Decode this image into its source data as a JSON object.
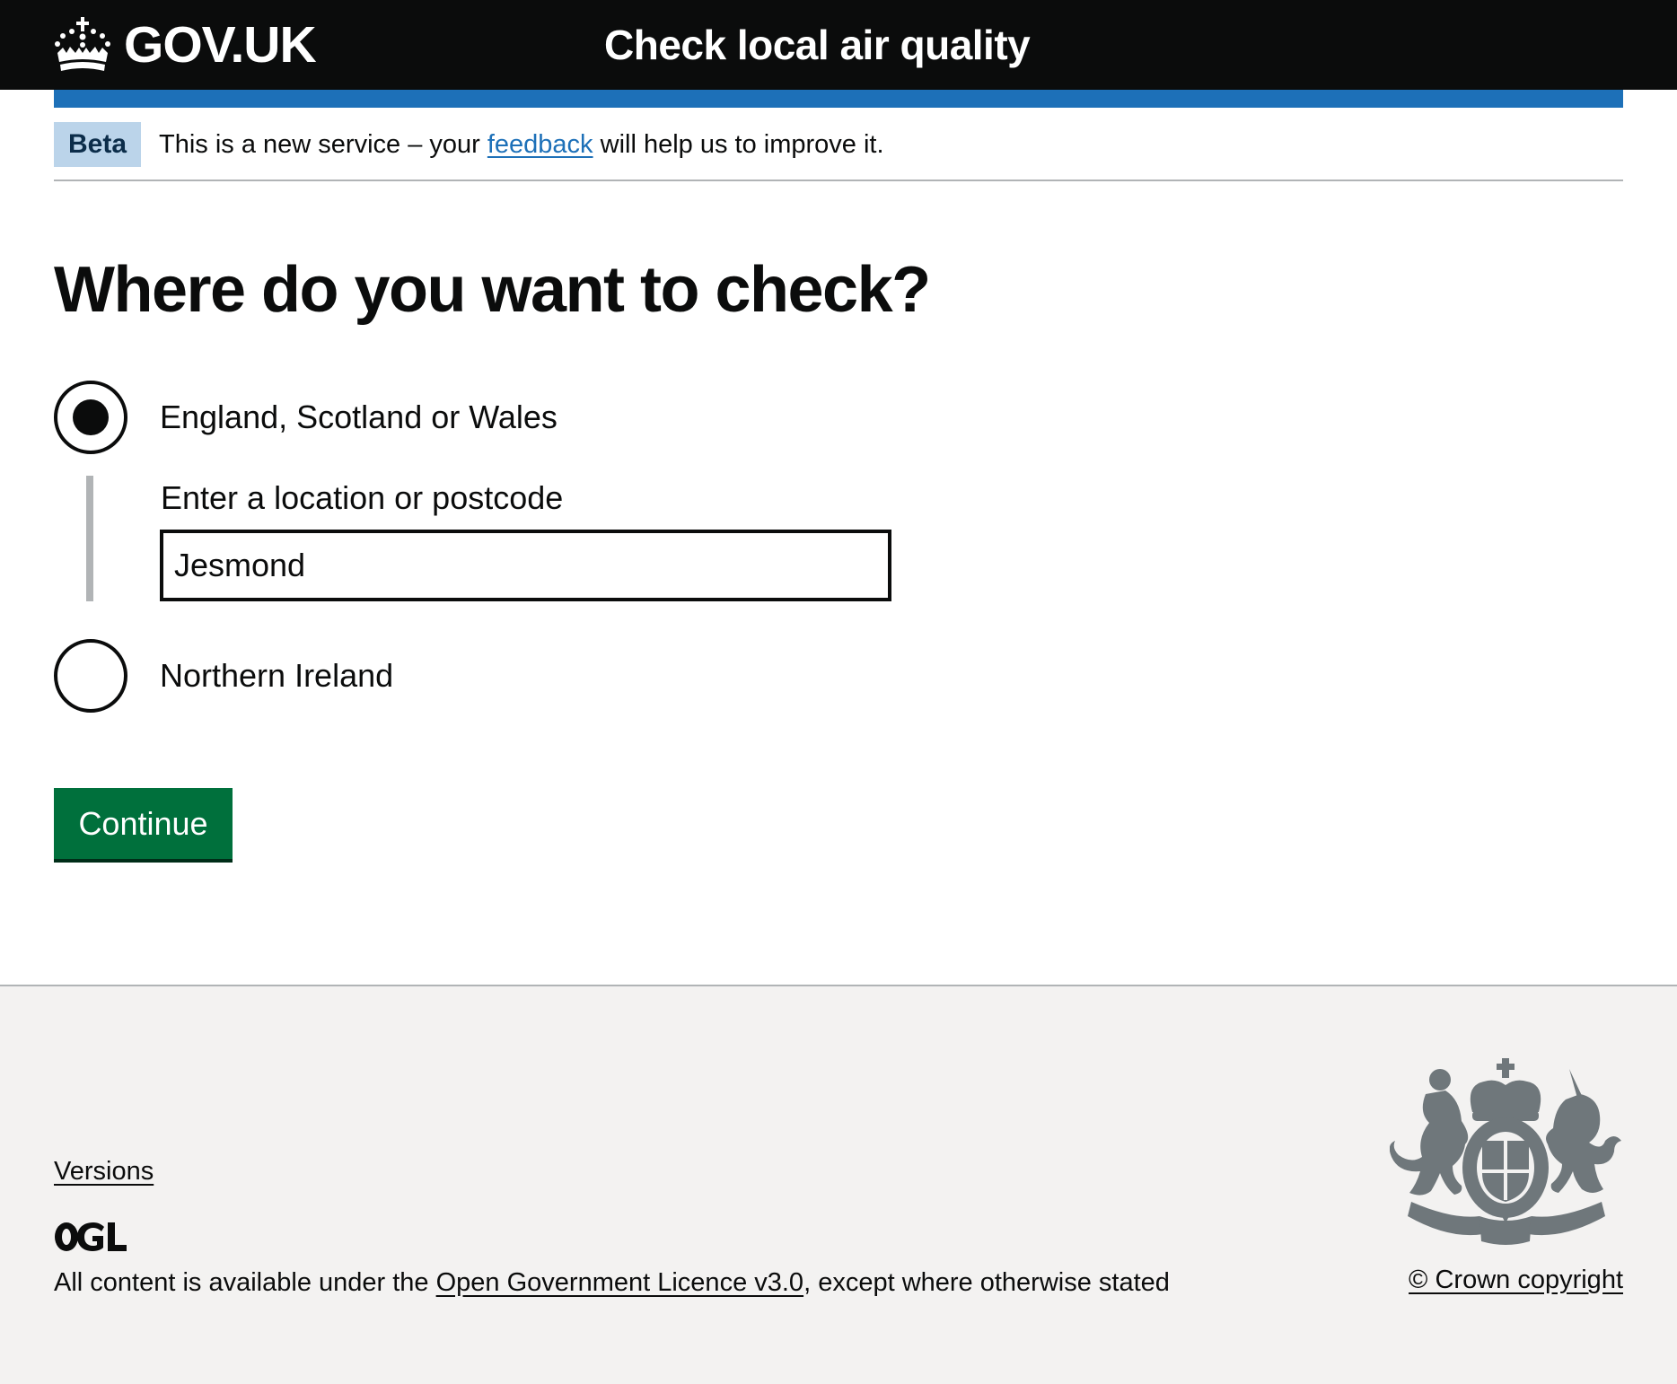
{
  "header": {
    "logo_text": "GOV.UK",
    "service_name": "Check local air quality"
  },
  "phase_banner": {
    "tag": "Beta",
    "text_before": "This is a new service – your ",
    "link_text": "feedback",
    "text_after": " will help us to improve it."
  },
  "main": {
    "heading": "Where do you want to check?",
    "options": [
      {
        "label": "England, Scotland or Wales",
        "selected": true
      },
      {
        "label": "Northern Ireland",
        "selected": false
      }
    ],
    "conditional": {
      "label": "Enter a location or postcode",
      "input_value": "Jesmond"
    },
    "continue_label": "Continue"
  },
  "footer": {
    "versions_link": "Versions",
    "ogl_logo": "OGL",
    "licence_before": "All content is available under the ",
    "licence_link": "Open Government Licence v3.0",
    "licence_after": ", except where otherwise stated",
    "crest_icon": "royal-coat-of-arms",
    "copyright": "© Crown copyright"
  },
  "colors": {
    "header_bg": "#0b0c0c",
    "brand_blue": "#1d70b8",
    "beta_tag_bg": "#bbd4ea",
    "button_green": "#00703c",
    "footer_bg": "#f3f2f1",
    "crest_grey": "#6f777b"
  }
}
